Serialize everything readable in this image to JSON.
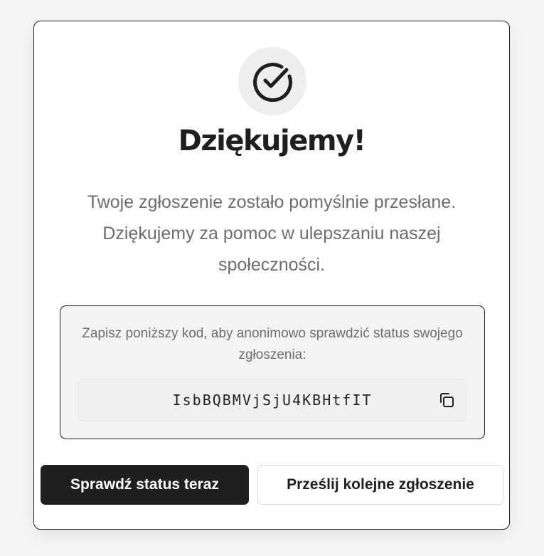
{
  "success_card": {
    "icon": "check-circle-icon",
    "title": "Dziękujemy!",
    "message": "Twoje zgłoszenie zostało pomyślnie przesłane. Dziękujemy za pomoc w ulepszaniu naszej społeczności."
  },
  "code_section": {
    "instruction": "Zapisz poniższy kod, aby anonimowo sprawdzić status swojego zgłoszenia:",
    "code": "IsbBQBMVjSjU4KBHtfIT",
    "copy_icon": "copy-icon"
  },
  "actions": {
    "check_status_label": "Sprawdź status teraz",
    "submit_another_label": "Prześlij kolejne zgłoszenie"
  },
  "colors": {
    "primary": "#1f1f1f",
    "muted_text": "#6d6d6d",
    "page_background": "#f5f5f5",
    "code_background": "#f3f3f3"
  }
}
